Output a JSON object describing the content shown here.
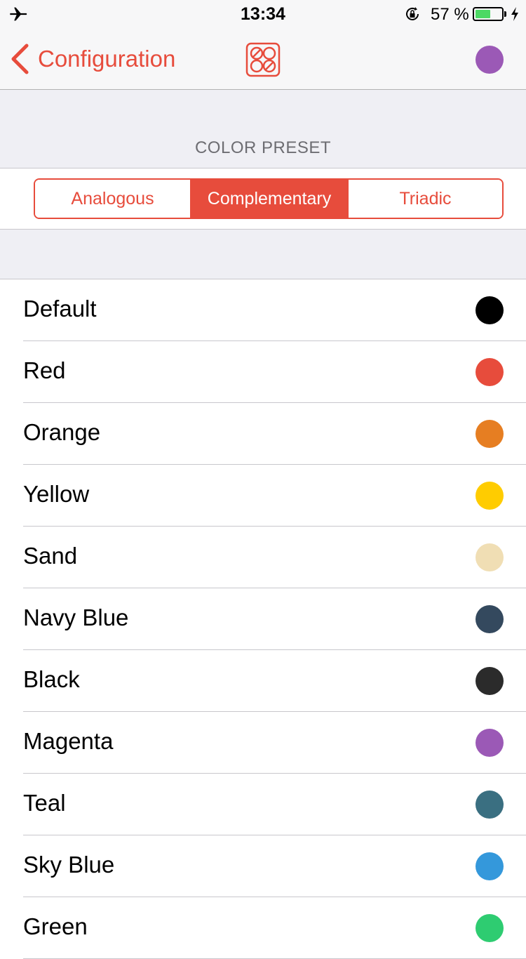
{
  "status_bar": {
    "time": "13:34",
    "battery_percent_label": "57 %",
    "battery_level": 0.57,
    "icons": [
      "airplane-icon",
      "rotation-lock-icon",
      "battery-icon",
      "charging-bolt-icon"
    ]
  },
  "nav": {
    "back_label": "Configuration",
    "center_icon": "palette-grid-icon",
    "current_color": "#9b59b6",
    "accent_color": "#e74c3c"
  },
  "section": {
    "title": "COLOR PRESET"
  },
  "segmented_control": {
    "options": [
      "Analogous",
      "Complementary",
      "Triadic"
    ],
    "selected": "Complementary"
  },
  "colors": [
    {
      "name": "Default",
      "hex": "#000000"
    },
    {
      "name": "Red",
      "hex": "#e74c3c"
    },
    {
      "name": "Orange",
      "hex": "#e67e22"
    },
    {
      "name": "Yellow",
      "hex": "#ffcc00"
    },
    {
      "name": "Sand",
      "hex": "#f0deb4"
    },
    {
      "name": "Navy Blue",
      "hex": "#34495e"
    },
    {
      "name": "Black",
      "hex": "#2b2b2b"
    },
    {
      "name": "Magenta",
      "hex": "#9b59b6"
    },
    {
      "name": "Teal",
      "hex": "#3a6f81"
    },
    {
      "name": "Sky Blue",
      "hex": "#3498db"
    },
    {
      "name": "Green",
      "hex": "#2ecc71"
    }
  ]
}
